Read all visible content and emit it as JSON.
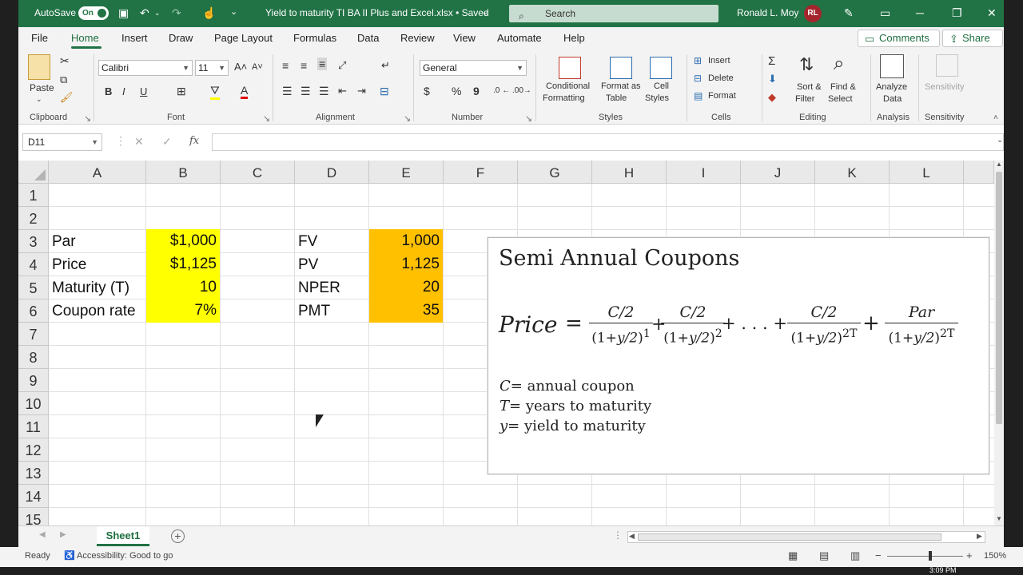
{
  "titlebar": {
    "autosave_label": "AutoSave",
    "autosave_state": "On",
    "filename": "Yield to maturity TI BA II Plus and Excel.xlsx • Saved",
    "search_placeholder": "Search",
    "user_name": "Ronald L. Moy",
    "user_initials": "RL"
  },
  "menu": {
    "tabs": [
      "File",
      "Home",
      "Insert",
      "Draw",
      "Page Layout",
      "Formulas",
      "Data",
      "Review",
      "View",
      "Automate",
      "Help"
    ],
    "comments_label": "Comments",
    "share_label": "Share"
  },
  "ribbon": {
    "paste": "Paste",
    "clipboard": "Clipboard",
    "font_name": "Calibri",
    "font_size": "11",
    "font": "Font",
    "alignment": "Alignment",
    "number_format": "General",
    "number": "Number",
    "conditional_formatting_1": "Conditional",
    "conditional_formatting_2": "Formatting",
    "format_as_table_1": "Format as",
    "format_as_table_2": "Table",
    "cell_styles_1": "Cell",
    "cell_styles_2": "Styles",
    "styles": "Styles",
    "insert": "Insert",
    "delete": "Delete",
    "format": "Format",
    "cells": "Cells",
    "sort_filter_1": "Sort &",
    "sort_filter_2": "Filter",
    "find_select_1": "Find &",
    "find_select_2": "Select",
    "editing": "Editing",
    "analyze_data_1": "Analyze",
    "analyze_data_2": "Data",
    "analysis": "Analysis",
    "sensitivity_btn": "Sensitivity",
    "sensitivity": "Sensitivity"
  },
  "formula_bar": {
    "name_box": "D11",
    "formula": ""
  },
  "grid": {
    "columns": [
      "A",
      "B",
      "C",
      "D",
      "E",
      "F",
      "G",
      "H",
      "I",
      "J",
      "K",
      "L"
    ],
    "rows": [
      "1",
      "2",
      "3",
      "4",
      "5",
      "6",
      "7",
      "8",
      "9",
      "10",
      "11",
      "12",
      "13",
      "14",
      "15"
    ],
    "cells": {
      "A3": "Par",
      "B3": "$1,000",
      "D3": "FV",
      "E3": "1,000",
      "A4": "Price",
      "B4": "$1,125",
      "D4": "PV",
      "E4": "1,125",
      "A5": "Maturity (T)",
      "B5": "10",
      "D5": "NPER",
      "E5": "20",
      "A6": "Coupon rate",
      "B6": "7%",
      "D6": "PMT",
      "E6": "35"
    },
    "fill_colors": {
      "yellow": "#ffff00",
      "orange": "#ffc000"
    }
  },
  "equation_box": {
    "title": "Semi Annual Coupons",
    "lhs": "Price",
    "equals": "=",
    "term_numerator": "C/2",
    "par_numerator": "Par",
    "denominator_base": "(1+",
    "y_over_2": "y/2",
    "exp_1": "1",
    "exp_2": "2",
    "exp_2t": "2T",
    "plus": "+",
    "ellipsis": "+ . . . +",
    "def_c_var": "C",
    "def_c_text": "= annual coupon",
    "def_t_var": "T",
    "def_t_text": "= years to maturity",
    "def_y_var": "y",
    "def_y_text": "= yield to maturity"
  },
  "sheet_tabs": {
    "active": "Sheet1"
  },
  "status": {
    "ready": "Ready",
    "accessibility": "Accessibility: Good to go",
    "zoom": "150%",
    "time": "3:09 PM"
  },
  "colors": {
    "excel_green": "#217346"
  }
}
